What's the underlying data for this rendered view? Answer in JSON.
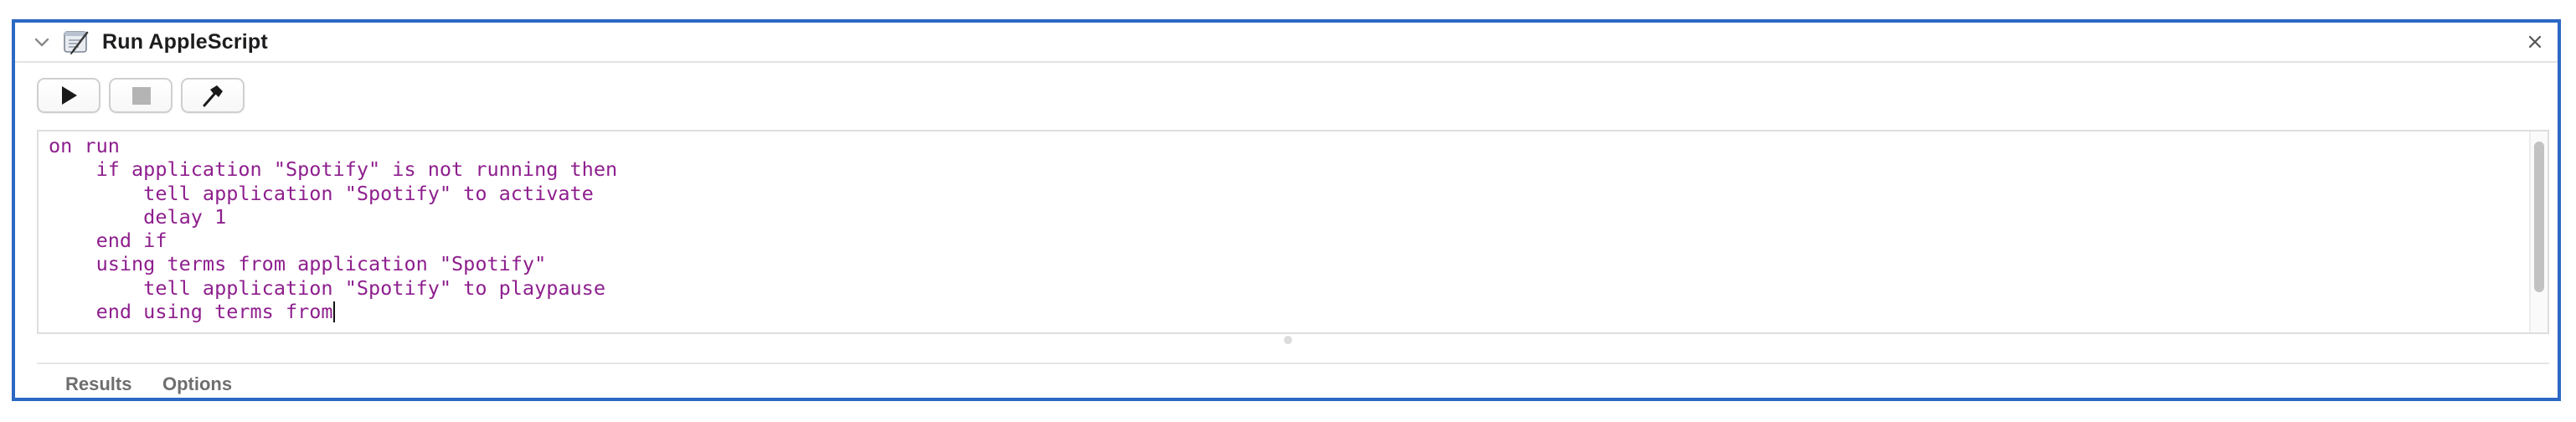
{
  "action": {
    "title": "Run AppleScript",
    "icon": "script-editor-icon"
  },
  "toolbar": {
    "run_icon": "play-icon",
    "stop_icon": "stop-icon",
    "compile_icon": "hammer-icon"
  },
  "editor": {
    "lines": [
      "on run",
      "    if application \"Spotify\" is not running then",
      "        tell application \"Spotify\" to activate",
      "        delay 1",
      "    end if",
      "    using terms from application \"Spotify\"",
      "        tell application \"Spotify\" to playpause",
      "    end using terms from"
    ],
    "text_color": "#8e1f8e"
  },
  "footer": {
    "tabs": [
      {
        "label": "Results"
      },
      {
        "label": "Options"
      }
    ]
  },
  "colors": {
    "panel_border": "#2b68c4"
  }
}
